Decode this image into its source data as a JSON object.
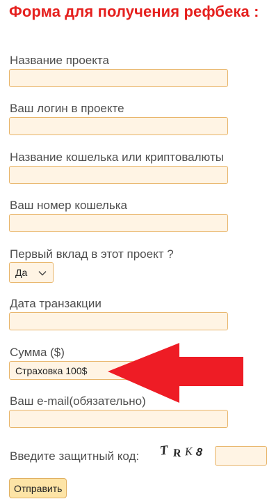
{
  "form": {
    "title": "Форма для получения рефбека :",
    "fields": {
      "project_name": {
        "label": "Название проекта",
        "value": ""
      },
      "project_login": {
        "label": "Ваш логин в проекте",
        "value": ""
      },
      "wallet_name": {
        "label": "Название кошелька или криптовалюты",
        "value": ""
      },
      "wallet_number": {
        "label": "Ваш номер кошелька",
        "value": ""
      },
      "first_deposit": {
        "label": "Первый вклад в этот проект ?",
        "selected": "Да"
      },
      "transaction_date": {
        "label": "Дата транзакции",
        "value": ""
      },
      "amount": {
        "label": "Сумма ($)",
        "selected": "Страховка 100$"
      },
      "email": {
        "label": "Ваш e-mail(обязательно)",
        "value": ""
      }
    },
    "captcha": {
      "label": "Введите защитный код:",
      "code": "TRK8",
      "value": ""
    },
    "submit_label": "Отправить"
  },
  "colors": {
    "title": "#e5201e",
    "field_bg": "#fff4e4",
    "field_border": "#e8b56a",
    "button_bg": "#fde4a6",
    "arrow": "#ee1c25"
  },
  "icons": {
    "select_chevron": "chevron-down-icon",
    "annotation": "red-arrow-icon"
  }
}
